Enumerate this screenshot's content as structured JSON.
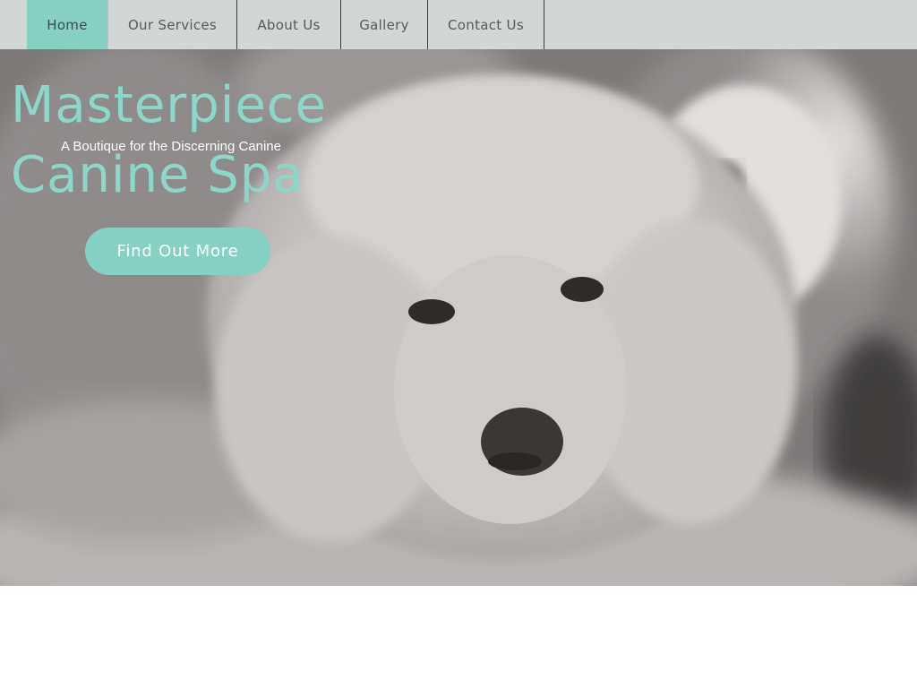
{
  "nav": {
    "items": [
      {
        "label": "Home",
        "active": true
      },
      {
        "label": "Our Services",
        "active": false
      },
      {
        "label": "About Us",
        "active": false
      },
      {
        "label": "Gallery",
        "active": false
      },
      {
        "label": "Contact Us",
        "active": false
      }
    ]
  },
  "hero": {
    "title_line1": "Masterpiece",
    "title_line2": "Canine Spa",
    "tagline": "A Boutique for the Discerning Canine",
    "cta_label": "Find Out More"
  },
  "colors": {
    "accent": "#86d0c4",
    "title": "#8dd6ca",
    "nav_bg": "#d4d6d5"
  }
}
